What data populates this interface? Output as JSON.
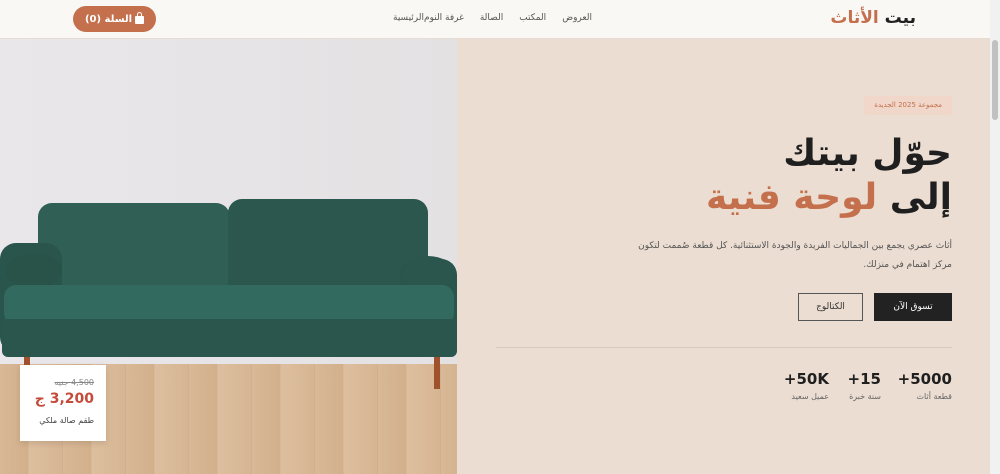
{
  "header": {
    "logo_main": "بيت",
    "logo_accent": "الأثاث",
    "nav": [
      "الرئيسية",
      "غرفة النوم",
      "الصالة",
      "المكتب",
      "العروض"
    ],
    "cart_label": "السلة (0)",
    "cart_icon": "shopping-bag-icon"
  },
  "hero": {
    "badge": "مجموعة 2025 الجديدة",
    "title_line1": "حوّل بيتك",
    "title_line2_prefix": "إلى",
    "title_line2_accent": "لوحة فنية",
    "description": "أثاث عصري يجمع بين الجماليات الفريدة والجودة الاستثنائية. كل قطعة صُممت لتكون مركز اهتمام في منزلك.",
    "primary_button": "تسوق الآن",
    "secondary_button": "الكتالوج",
    "stats": [
      {
        "value": "5000+",
        "label": "قطعة أثاث"
      },
      {
        "value": "15+",
        "label": "سنة خبرة"
      },
      {
        "value": "50K+",
        "label": "عميل سعيد"
      }
    ]
  },
  "product_card": {
    "old_price": "4,500 جنيه",
    "new_price": "3,200 ج",
    "name": "طقم صالة ملكي"
  },
  "colors": {
    "accent": "#c4704d",
    "dark": "#222222",
    "hero_bg": "#ebddd1",
    "sofa": "#2e5d54"
  }
}
